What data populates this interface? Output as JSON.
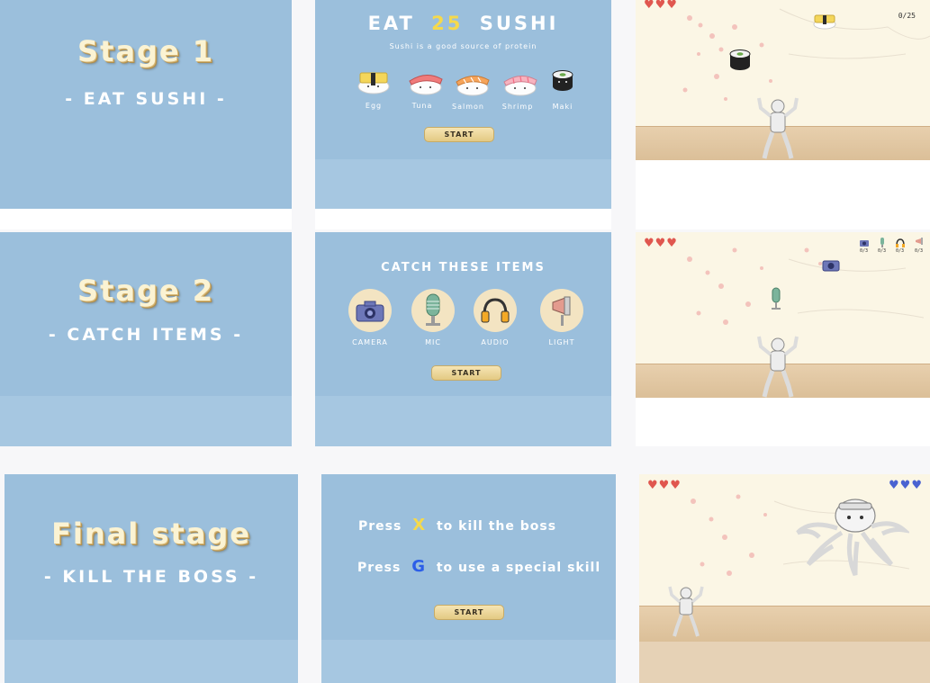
{
  "stage1": {
    "title": "Stage 1",
    "subtitle": "- EAT SUSHI -",
    "intro_title_prefix": "EAT",
    "intro_title_number": "25",
    "intro_title_suffix": "SUSHI",
    "intro_subtitle": "Sushi is a good source of protein",
    "sushi": [
      "Egg",
      "Tuna",
      "Salmon",
      "Shrimp",
      "Maki"
    ],
    "start_label": "START",
    "counter": "0/25",
    "hearts": "♥♥♥"
  },
  "stage2": {
    "title": "Stage 2",
    "subtitle": "- CATCH ITEMS -",
    "intro_title": "CATCH THESE ITEMS",
    "items": [
      "CAMERA",
      "MIC",
      "AUDIO",
      "LIGHT"
    ],
    "start_label": "START",
    "item_counters": [
      "0/3",
      "0/3",
      "0/3",
      "0/3"
    ],
    "hearts": "♥♥♥"
  },
  "stage3": {
    "title": "Final stage",
    "subtitle": "- KILL THE BOSS -",
    "line1_prefix": "Press",
    "line1_key": "X",
    "line1_suffix": "to kill the boss",
    "line2_prefix": "Press",
    "line2_key": "G",
    "line2_suffix": "to use a special skill",
    "start_label": "START",
    "player_hearts": "♥♥♥",
    "boss_hearts": "♥♥♥"
  },
  "colors": {
    "panel_blue": "#9bbfdc",
    "title_cream": "#fbf3d3",
    "accent_yellow": "#f5d94c",
    "accent_blue": "#2c5ee8",
    "heart_red": "#e0574f",
    "heart_blue": "#4a63d1"
  }
}
